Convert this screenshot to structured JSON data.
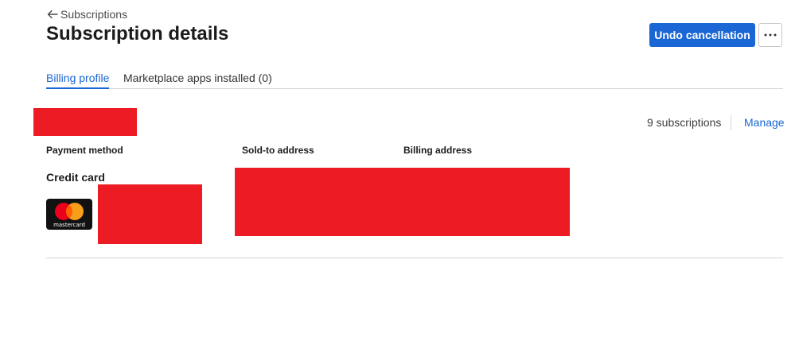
{
  "header": {
    "back_label": "Subscriptions",
    "title": "Subscription details",
    "primary_action": "Undo cancellation",
    "more_label": "..."
  },
  "tabs": [
    {
      "label": "Billing profile",
      "active": true
    },
    {
      "label": "Marketplace apps installed (0)",
      "active": false
    }
  ],
  "profile": {
    "subscriptions_count": "9 subscriptions",
    "manage_label": "Manage",
    "columns": {
      "payment_method": "Payment method",
      "sold_to": "Sold-to address",
      "billing": "Billing address"
    },
    "payment_type": "Credit card",
    "card_brand": "mastercard"
  },
  "colors": {
    "accent": "#1a66d4",
    "redaction": "#ed1c24",
    "divider": "#d6d6d6"
  },
  "icons": {
    "back": "arrow-left-icon",
    "more": "more-horizontal-icon",
    "card": "mastercard-logo-icon"
  }
}
